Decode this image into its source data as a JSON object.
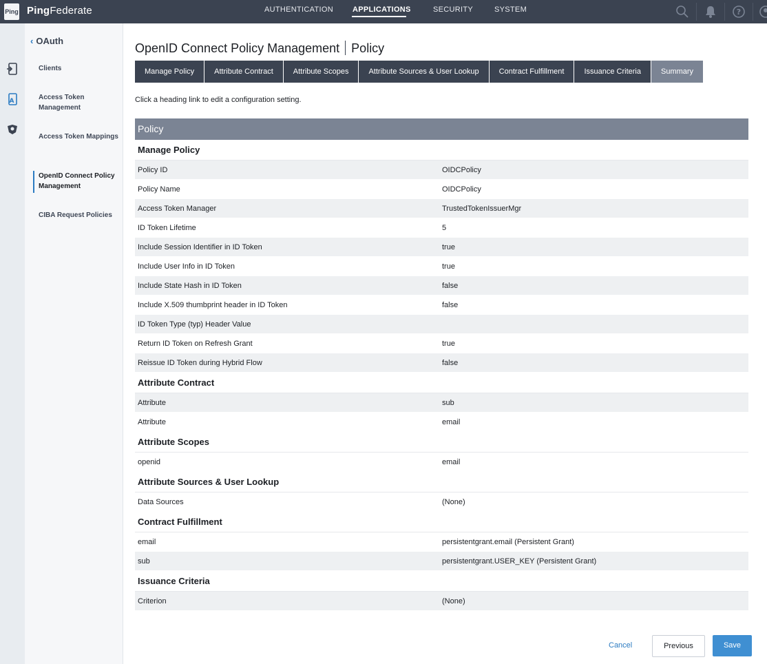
{
  "app": {
    "logo_text": "Ping",
    "brand_bold": "Ping",
    "brand_rest": "Federate"
  },
  "topnav": {
    "items": [
      {
        "label": "AUTHENTICATION"
      },
      {
        "label": "APPLICATIONS",
        "active": true
      },
      {
        "label": "SECURITY"
      },
      {
        "label": "SYSTEM"
      }
    ],
    "icons": [
      "search-icon",
      "bell-icon",
      "help-icon",
      "user-icon"
    ]
  },
  "rail": {
    "icons": [
      "app-phone-icon",
      "oauth-app-icon",
      "federation-hub-icon"
    ]
  },
  "leftnav": {
    "back_label": "OAuth",
    "items": [
      {
        "label": "Clients"
      },
      {
        "label": "Access Token Management"
      },
      {
        "label": "Access Token Mappings"
      },
      {
        "label": "OpenID Connect Policy Management",
        "active": true
      },
      {
        "label": "CIBA Request Policies"
      }
    ]
  },
  "page": {
    "title": "OpenID Connect Policy Management",
    "subtitle": "Policy",
    "hint": "Click a heading link to edit a configuration setting."
  },
  "tabs": [
    {
      "label": "Manage Policy"
    },
    {
      "label": "Attribute Contract"
    },
    {
      "label": "Attribute Scopes"
    },
    {
      "label": "Attribute Sources & User Lookup"
    },
    {
      "label": "Contract Fulfillment"
    },
    {
      "label": "Issuance Criteria"
    },
    {
      "label": "Summary",
      "active": true
    }
  ],
  "summary": {
    "header": "Policy",
    "sections": [
      {
        "title": "Manage Policy",
        "rows": [
          {
            "key": "Policy ID",
            "value": "OIDCPolicy"
          },
          {
            "key": "Policy Name",
            "value": "OIDCPolicy"
          },
          {
            "key": "Access Token Manager",
            "value": "TrustedTokenIssuerMgr"
          },
          {
            "key": "ID Token Lifetime",
            "value": "5"
          },
          {
            "key": "Include Session Identifier in ID Token",
            "value": "true"
          },
          {
            "key": "Include User Info in ID Token",
            "value": "true"
          },
          {
            "key": "Include State Hash in ID Token",
            "value": "false"
          },
          {
            "key": "Include X.509 thumbprint header in ID Token",
            "value": "false"
          },
          {
            "key": "ID Token Type (typ) Header Value",
            "value": ""
          },
          {
            "key": "Return ID Token on Refresh Grant",
            "value": "true"
          },
          {
            "key": "Reissue ID Token during Hybrid Flow",
            "value": "false"
          }
        ]
      },
      {
        "title": "Attribute Contract",
        "rows": [
          {
            "key": "Attribute",
            "value": "sub"
          },
          {
            "key": "Attribute",
            "value": "email"
          }
        ]
      },
      {
        "title": "Attribute Scopes",
        "rows": [
          {
            "key": "openid",
            "value": "email"
          }
        ]
      },
      {
        "title": "Attribute Sources & User Lookup",
        "rows": [
          {
            "key": "Data Sources",
            "value": "(None)"
          }
        ]
      },
      {
        "title": "Contract Fulfillment",
        "rows": [
          {
            "key": "email",
            "value": "persistentgrant.email (Persistent Grant)"
          },
          {
            "key": "sub",
            "value": "persistentgrant.USER_KEY (Persistent Grant)"
          }
        ]
      },
      {
        "title": "Issuance Criteria",
        "rows": [
          {
            "key": "Criterion",
            "value": "(None)"
          }
        ]
      }
    ]
  },
  "footer": {
    "cancel": "Cancel",
    "previous": "Previous",
    "save": "Save"
  },
  "colors": {
    "topbar": "#3b4351",
    "tab_active": "#7b8494",
    "accent": "#2b7bc2",
    "save": "#3f8fd2"
  }
}
